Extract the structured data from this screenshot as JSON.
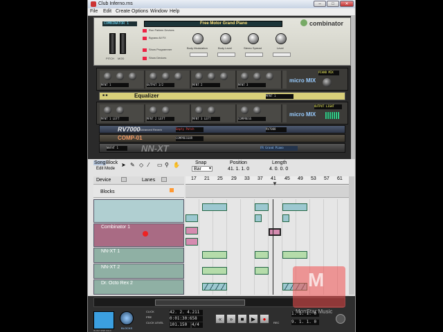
{
  "window": {
    "title": "Club Inferno.rns"
  },
  "menu": [
    "File",
    "Edit",
    "Create",
    "Options",
    "Window",
    "Help"
  ],
  "combinator": {
    "name": "COMBINATOR 1",
    "patch": "Free Motor Grand Piano",
    "brand": "combinator",
    "buttons": [
      "Run Pattern Devices",
      "Bypass All FX",
      "Show Programmer",
      "Show Devices"
    ],
    "knobs": [
      "Body Modulation",
      "Body Level",
      "Stereo Spread",
      "Level"
    ],
    "wheels": [
      "PITCH",
      "MOD"
    ]
  },
  "rack": {
    "mix1_channels": [
      "MFNT 1",
      "OUTPUT 1/2",
      "MFNT 2",
      "MFNT 3"
    ],
    "mix1_label": "micro MIX",
    "mix1_patch": "PIANO MIX",
    "eq_name": "Equalizer",
    "eq_tag": "MFNT 1",
    "mix2_channels": [
      "MFNT 1 LEFT",
      "MFNT 2 LEFT",
      "MFNT 3 LEFT",
      "COMPRESS"
    ],
    "mix2_patch": "OUTPUT LIGHT",
    "mix2_label": "micro MIX",
    "rv7000_name": "RV7000",
    "rv7000_sub": "Advanced Reverb",
    "rv7000_patch": "Empty Patch",
    "rv7000_tag": "RV7000",
    "comp_name": "COMP-01",
    "comp_tag": "COMPRESSOR",
    "nnxt_name": "NN-XT",
    "nnxt_tag": "NNFNT 1",
    "nnxt_patch": "FR Grand Piano"
  },
  "toolbar": {
    "song": "Song",
    "block": "Block",
    "edit_mode": "Edit Mode",
    "snap_label": "Snap",
    "snap_value": "Bar",
    "position_label": "Position",
    "position_value": "41. 1. 1. 0",
    "length_label": "Length",
    "length_value": "4. 0. 0. 0"
  },
  "track_header": {
    "device": "Device",
    "lanes": "Lanes",
    "blocks": "Blocks"
  },
  "ruler": [
    "17",
    "21",
    "25",
    "29",
    "33",
    "37",
    "41",
    "45",
    "49",
    "53",
    "57",
    "61"
  ],
  "tracks": [
    "Combinator 1",
    "NN-XT 1",
    "NN-XT 2",
    "Dr. Octo Rex 2"
  ],
  "transport": {
    "blocks_label": "BLOCKS",
    "click_label": "CLICK",
    "pre_label": "PRE",
    "click_level": "CLICK LEVEL",
    "bars": "42. 2. 4.211",
    "time": "0:01:30:658",
    "tempo": "101.150",
    "sig": "4/4",
    "loop_l": "1. 1. 1. 0",
    "loop_r": "9. 1. 1. 0",
    "rec": "REC",
    "dsp": "IN  OUT  DSP  CALC"
  },
  "watermark": "MonStar Music"
}
